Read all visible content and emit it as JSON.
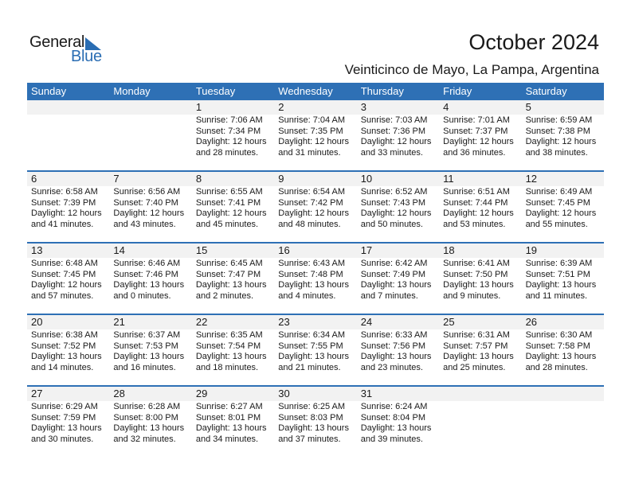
{
  "logo": {
    "general": "General",
    "blue": "Blue"
  },
  "header": {
    "title": "October 2024",
    "location": "Veinticinco de Mayo, La Pampa, Argentina"
  },
  "colors": {
    "accent": "#2e70b5",
    "day_number_bg": "#f2f2f2"
  },
  "weekdays": [
    "Sunday",
    "Monday",
    "Tuesday",
    "Wednesday",
    "Thursday",
    "Friday",
    "Saturday"
  ],
  "weeks": [
    [
      null,
      null,
      {
        "day": "1",
        "sunrise": "Sunrise: 7:06 AM",
        "sunset": "Sunset: 7:34 PM",
        "daylight1": "Daylight: 12 hours",
        "daylight2": "and 28 minutes."
      },
      {
        "day": "2",
        "sunrise": "Sunrise: 7:04 AM",
        "sunset": "Sunset: 7:35 PM",
        "daylight1": "Daylight: 12 hours",
        "daylight2": "and 31 minutes."
      },
      {
        "day": "3",
        "sunrise": "Sunrise: 7:03 AM",
        "sunset": "Sunset: 7:36 PM",
        "daylight1": "Daylight: 12 hours",
        "daylight2": "and 33 minutes."
      },
      {
        "day": "4",
        "sunrise": "Sunrise: 7:01 AM",
        "sunset": "Sunset: 7:37 PM",
        "daylight1": "Daylight: 12 hours",
        "daylight2": "and 36 minutes."
      },
      {
        "day": "5",
        "sunrise": "Sunrise: 6:59 AM",
        "sunset": "Sunset: 7:38 PM",
        "daylight1": "Daylight: 12 hours",
        "daylight2": "and 38 minutes."
      }
    ],
    [
      {
        "day": "6",
        "sunrise": "Sunrise: 6:58 AM",
        "sunset": "Sunset: 7:39 PM",
        "daylight1": "Daylight: 12 hours",
        "daylight2": "and 41 minutes."
      },
      {
        "day": "7",
        "sunrise": "Sunrise: 6:56 AM",
        "sunset": "Sunset: 7:40 PM",
        "daylight1": "Daylight: 12 hours",
        "daylight2": "and 43 minutes."
      },
      {
        "day": "8",
        "sunrise": "Sunrise: 6:55 AM",
        "sunset": "Sunset: 7:41 PM",
        "daylight1": "Daylight: 12 hours",
        "daylight2": "and 45 minutes."
      },
      {
        "day": "9",
        "sunrise": "Sunrise: 6:54 AM",
        "sunset": "Sunset: 7:42 PM",
        "daylight1": "Daylight: 12 hours",
        "daylight2": "and 48 minutes."
      },
      {
        "day": "10",
        "sunrise": "Sunrise: 6:52 AM",
        "sunset": "Sunset: 7:43 PM",
        "daylight1": "Daylight: 12 hours",
        "daylight2": "and 50 minutes."
      },
      {
        "day": "11",
        "sunrise": "Sunrise: 6:51 AM",
        "sunset": "Sunset: 7:44 PM",
        "daylight1": "Daylight: 12 hours",
        "daylight2": "and 53 minutes."
      },
      {
        "day": "12",
        "sunrise": "Sunrise: 6:49 AM",
        "sunset": "Sunset: 7:45 PM",
        "daylight1": "Daylight: 12 hours",
        "daylight2": "and 55 minutes."
      }
    ],
    [
      {
        "day": "13",
        "sunrise": "Sunrise: 6:48 AM",
        "sunset": "Sunset: 7:45 PM",
        "daylight1": "Daylight: 12 hours",
        "daylight2": "and 57 minutes."
      },
      {
        "day": "14",
        "sunrise": "Sunrise: 6:46 AM",
        "sunset": "Sunset: 7:46 PM",
        "daylight1": "Daylight: 13 hours",
        "daylight2": "and 0 minutes."
      },
      {
        "day": "15",
        "sunrise": "Sunrise: 6:45 AM",
        "sunset": "Sunset: 7:47 PM",
        "daylight1": "Daylight: 13 hours",
        "daylight2": "and 2 minutes."
      },
      {
        "day": "16",
        "sunrise": "Sunrise: 6:43 AM",
        "sunset": "Sunset: 7:48 PM",
        "daylight1": "Daylight: 13 hours",
        "daylight2": "and 4 minutes."
      },
      {
        "day": "17",
        "sunrise": "Sunrise: 6:42 AM",
        "sunset": "Sunset: 7:49 PM",
        "daylight1": "Daylight: 13 hours",
        "daylight2": "and 7 minutes."
      },
      {
        "day": "18",
        "sunrise": "Sunrise: 6:41 AM",
        "sunset": "Sunset: 7:50 PM",
        "daylight1": "Daylight: 13 hours",
        "daylight2": "and 9 minutes."
      },
      {
        "day": "19",
        "sunrise": "Sunrise: 6:39 AM",
        "sunset": "Sunset: 7:51 PM",
        "daylight1": "Daylight: 13 hours",
        "daylight2": "and 11 minutes."
      }
    ],
    [
      {
        "day": "20",
        "sunrise": "Sunrise: 6:38 AM",
        "sunset": "Sunset: 7:52 PM",
        "daylight1": "Daylight: 13 hours",
        "daylight2": "and 14 minutes."
      },
      {
        "day": "21",
        "sunrise": "Sunrise: 6:37 AM",
        "sunset": "Sunset: 7:53 PM",
        "daylight1": "Daylight: 13 hours",
        "daylight2": "and 16 minutes."
      },
      {
        "day": "22",
        "sunrise": "Sunrise: 6:35 AM",
        "sunset": "Sunset: 7:54 PM",
        "daylight1": "Daylight: 13 hours",
        "daylight2": "and 18 minutes."
      },
      {
        "day": "23",
        "sunrise": "Sunrise: 6:34 AM",
        "sunset": "Sunset: 7:55 PM",
        "daylight1": "Daylight: 13 hours",
        "daylight2": "and 21 minutes."
      },
      {
        "day": "24",
        "sunrise": "Sunrise: 6:33 AM",
        "sunset": "Sunset: 7:56 PM",
        "daylight1": "Daylight: 13 hours",
        "daylight2": "and 23 minutes."
      },
      {
        "day": "25",
        "sunrise": "Sunrise: 6:31 AM",
        "sunset": "Sunset: 7:57 PM",
        "daylight1": "Daylight: 13 hours",
        "daylight2": "and 25 minutes."
      },
      {
        "day": "26",
        "sunrise": "Sunrise: 6:30 AM",
        "sunset": "Sunset: 7:58 PM",
        "daylight1": "Daylight: 13 hours",
        "daylight2": "and 28 minutes."
      }
    ],
    [
      {
        "day": "27",
        "sunrise": "Sunrise: 6:29 AM",
        "sunset": "Sunset: 7:59 PM",
        "daylight1": "Daylight: 13 hours",
        "daylight2": "and 30 minutes."
      },
      {
        "day": "28",
        "sunrise": "Sunrise: 6:28 AM",
        "sunset": "Sunset: 8:00 PM",
        "daylight1": "Daylight: 13 hours",
        "daylight2": "and 32 minutes."
      },
      {
        "day": "29",
        "sunrise": "Sunrise: 6:27 AM",
        "sunset": "Sunset: 8:01 PM",
        "daylight1": "Daylight: 13 hours",
        "daylight2": "and 34 minutes."
      },
      {
        "day": "30",
        "sunrise": "Sunrise: 6:25 AM",
        "sunset": "Sunset: 8:03 PM",
        "daylight1": "Daylight: 13 hours",
        "daylight2": "and 37 minutes."
      },
      {
        "day": "31",
        "sunrise": "Sunrise: 6:24 AM",
        "sunset": "Sunset: 8:04 PM",
        "daylight1": "Daylight: 13 hours",
        "daylight2": "and 39 minutes."
      },
      null,
      null
    ]
  ]
}
